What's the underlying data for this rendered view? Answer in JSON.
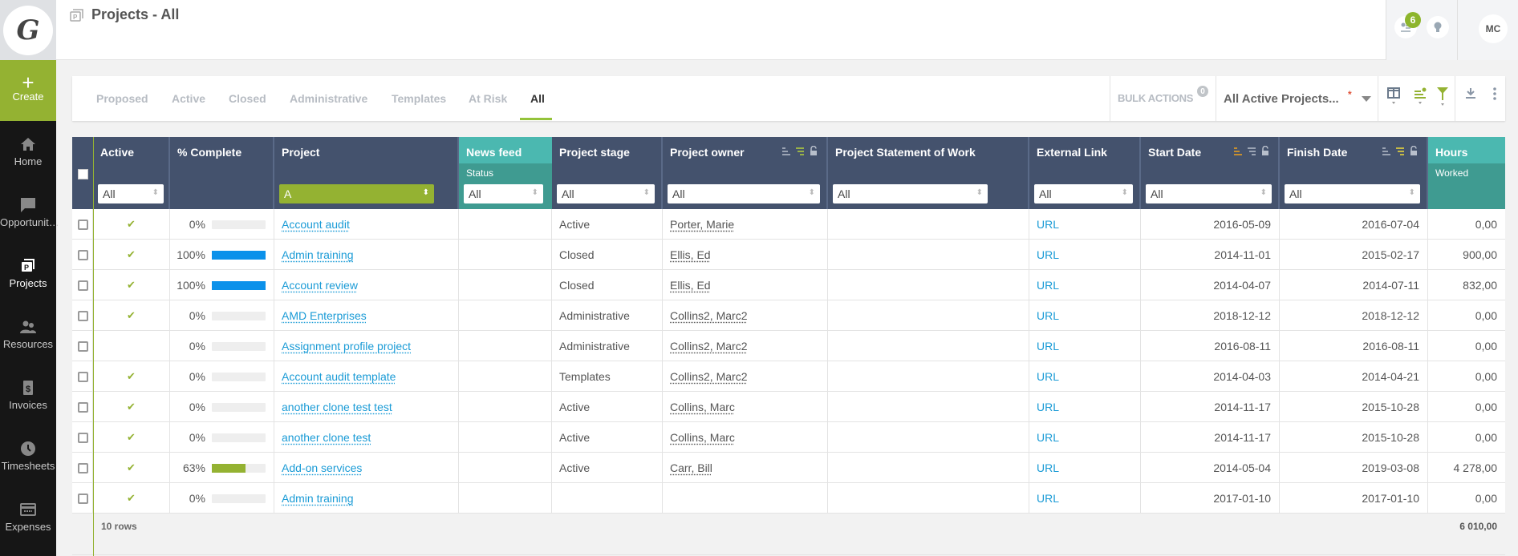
{
  "app": {
    "logo_letter": "G",
    "page_title": "Projects - All"
  },
  "sidebar": {
    "create_label": "Create",
    "items": [
      {
        "label": "Home",
        "icon": "home-icon",
        "active": false
      },
      {
        "label": "Opportunit…",
        "icon": "chat-bubble-icon",
        "active": false
      },
      {
        "label": "Projects",
        "icon": "projects-folder-icon",
        "active": true
      },
      {
        "label": "Resources",
        "icon": "people-icon",
        "active": false
      },
      {
        "label": "Invoices",
        "icon": "invoice-dollar-icon",
        "active": false
      },
      {
        "label": "Timesheets",
        "icon": "clock-icon",
        "active": false
      },
      {
        "label": "Expenses",
        "icon": "card-icon",
        "active": false
      }
    ]
  },
  "topbar": {
    "notification_count": "6",
    "user_initials": "MC"
  },
  "tabs": [
    {
      "label": "Proposed",
      "active": false
    },
    {
      "label": "Active",
      "active": false
    },
    {
      "label": "Closed",
      "active": false
    },
    {
      "label": "Administrative",
      "active": false
    },
    {
      "label": "Templates",
      "active": false
    },
    {
      "label": "At Risk",
      "active": false
    },
    {
      "label": "All",
      "active": true
    }
  ],
  "toolbar": {
    "bulk_actions_label": "BULK ACTIONS",
    "bulk_actions_count": "0",
    "view_selector": "All Active Projects...",
    "view_modified_marker": "*"
  },
  "table": {
    "columns": [
      {
        "key": "active",
        "label": "Active",
        "sub": "",
        "filter": "All"
      },
      {
        "key": "pct",
        "label": "% Complete",
        "sub": "",
        "filter": null
      },
      {
        "key": "project",
        "label": "Project",
        "sub": "",
        "filter": "A"
      },
      {
        "key": "news",
        "label": "News feed",
        "sub": "Status",
        "filter": "All"
      },
      {
        "key": "stage",
        "label": "Project stage",
        "sub": "",
        "filter": "All"
      },
      {
        "key": "owner",
        "label": "Project owner",
        "sub": "",
        "filter": "All"
      },
      {
        "key": "sow",
        "label": "Project Statement of Work",
        "sub": "",
        "filter": "All"
      },
      {
        "key": "link",
        "label": "External Link",
        "sub": "",
        "filter": "All"
      },
      {
        "key": "start",
        "label": "Start Date",
        "sub": "",
        "filter": "All"
      },
      {
        "key": "finish",
        "label": "Finish Date",
        "sub": "",
        "filter": "All"
      },
      {
        "key": "hours",
        "label": "Hours",
        "sub": "Worked",
        "filter": null
      }
    ],
    "rows": [
      {
        "active": true,
        "pct": "0%",
        "progress": 0,
        "project": "Account audit",
        "stage": "Active",
        "owner": "Porter, Marie",
        "link": "URL",
        "start": "2016-05-09",
        "finish": "2016-07-04",
        "hours": "0,00"
      },
      {
        "active": true,
        "pct": "100%",
        "progress": 100,
        "project": "Admin training",
        "stage": "Closed",
        "owner": "Ellis, Ed",
        "link": "URL",
        "start": "2014-11-01",
        "finish": "2015-02-17",
        "hours": "900,00"
      },
      {
        "active": true,
        "pct": "100%",
        "progress": 100,
        "project": "Account review",
        "stage": "Closed",
        "owner": "Ellis, Ed",
        "link": "URL",
        "start": "2014-04-07",
        "finish": "2014-07-11",
        "hours": "832,00"
      },
      {
        "active": true,
        "pct": "0%",
        "progress": 0,
        "project": "AMD Enterprises",
        "stage": "Administrative",
        "owner": "Collins2, Marc2",
        "link": "URL",
        "start": "2018-12-12",
        "finish": "2018-12-12",
        "hours": "0,00"
      },
      {
        "active": false,
        "pct": "0%",
        "progress": 0,
        "project": "Assignment profile project",
        "stage": "Administrative",
        "owner": "Collins2, Marc2",
        "link": "URL",
        "start": "2016-08-11",
        "finish": "2016-08-11",
        "hours": "0,00"
      },
      {
        "active": true,
        "pct": "0%",
        "progress": 0,
        "project": "Account audit template",
        "stage": "Templates",
        "owner": "Collins2, Marc2",
        "link": "URL",
        "start": "2014-04-03",
        "finish": "2014-04-21",
        "hours": "0,00"
      },
      {
        "active": true,
        "pct": "0%",
        "progress": 0,
        "project": "another clone test test",
        "stage": "Active",
        "owner": "Collins, Marc",
        "link": "URL",
        "start": "2014-11-17",
        "finish": "2015-10-28",
        "hours": "0,00"
      },
      {
        "active": true,
        "pct": "0%",
        "progress": 0,
        "project": "another clone test",
        "stage": "Active",
        "owner": "Collins, Marc",
        "link": "URL",
        "start": "2014-11-17",
        "finish": "2015-10-28",
        "hours": "0,00"
      },
      {
        "active": true,
        "pct": "63%",
        "progress": 63,
        "project": "Add-on services",
        "stage": "Active",
        "owner": "Carr, Bill",
        "link": "URL",
        "start": "2014-05-04",
        "finish": "2019-03-08",
        "hours": "4 278,00"
      },
      {
        "active": true,
        "pct": "0%",
        "progress": 0,
        "project": "Admin training",
        "stage": "",
        "owner": "",
        "link": "URL",
        "start": "2017-01-10",
        "finish": "2017-01-10",
        "hours": "0,00"
      }
    ],
    "footer": {
      "row_count": "10 rows",
      "hours_total": "6 010,00"
    }
  },
  "colors": {
    "accent_green": "#94b232",
    "header_navy": "#44526d",
    "teal": "#4bb8b0",
    "link_blue": "#1a9bd6",
    "progress_blue": "#0b91ea"
  }
}
